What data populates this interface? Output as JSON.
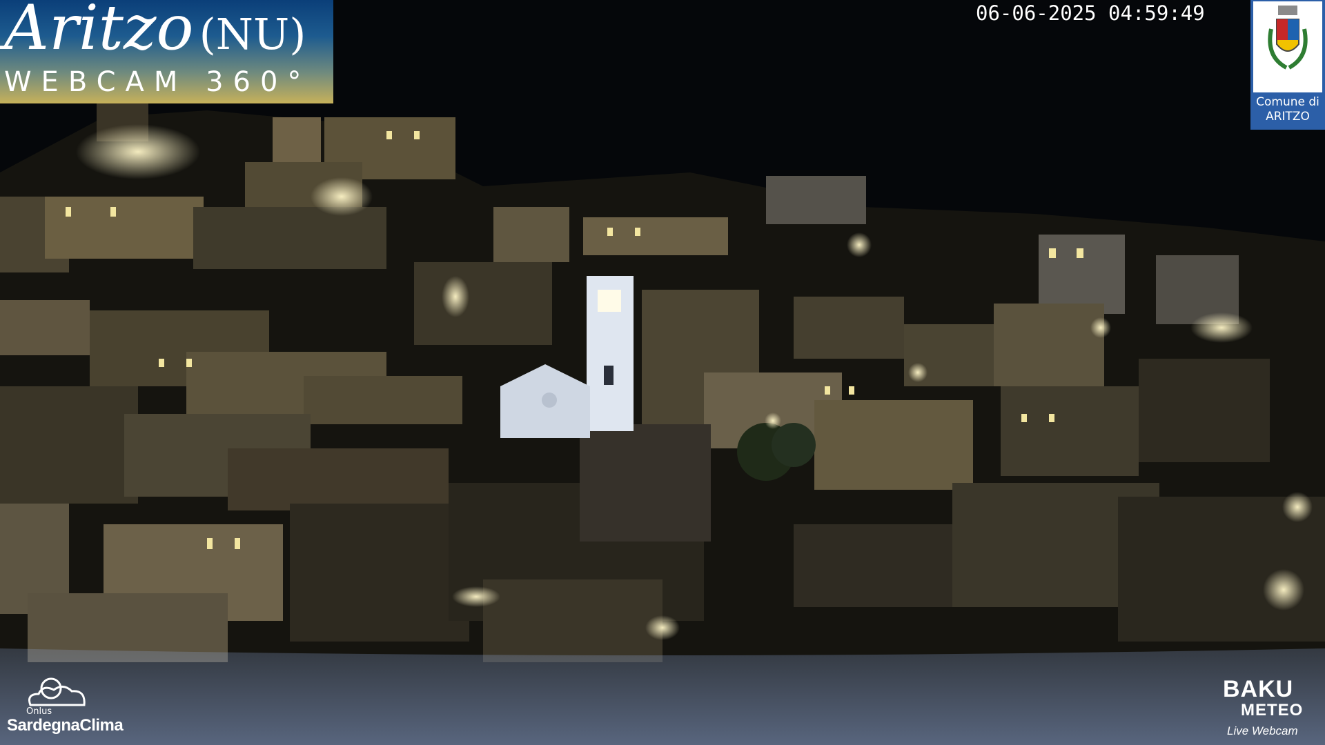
{
  "overlay": {
    "title": "Aritzo",
    "province": "(NU)",
    "subtitle": "WEBCAM 360°",
    "timestamp": "06-06-2025 04:59:49",
    "comune_line1": "Comune di",
    "comune_line2": "ARITZO",
    "left_brand_sub": "Onlus",
    "left_brand": "SardegnaClima",
    "right_brand_line1": "BAKU",
    "right_brand_line2": "METEO",
    "right_brand_tag": "Live Webcam"
  },
  "colors": {
    "sky": "#05070a",
    "window_light": "#f3e6a0",
    "church": "#dfe6f0",
    "title_box_top": "#0b3f79",
    "title_box_bottom": "#c7b15a",
    "bottom_band": "#8fa8d8"
  },
  "icons": {
    "crest": "municipal-crest-icon",
    "cloud": "cloud-sun-icon"
  }
}
